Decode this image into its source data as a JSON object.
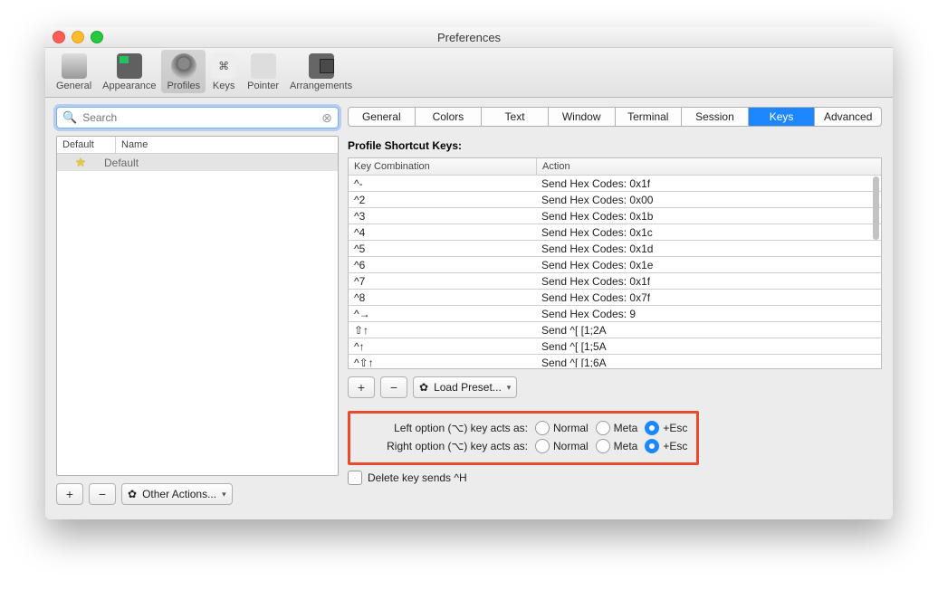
{
  "window": {
    "title": "Preferences"
  },
  "toolbar": [
    {
      "label": "General"
    },
    {
      "label": "Appearance"
    },
    {
      "label": "Profiles",
      "selected": true
    },
    {
      "label": "Keys",
      "glyph": "⌘"
    },
    {
      "label": "Pointer"
    },
    {
      "label": "Arrangements"
    }
  ],
  "search": {
    "placeholder": "Search"
  },
  "profile_headers": {
    "c1": "Default",
    "c2": "Name"
  },
  "profiles": [
    {
      "name": "Default",
      "is_default": true
    }
  ],
  "left_actions": {
    "add": "+",
    "remove": "−",
    "other": "Other Actions..."
  },
  "tabs": [
    "General",
    "Colors",
    "Text",
    "Window",
    "Terminal",
    "Session",
    "Keys",
    "Advanced"
  ],
  "active_tab": "Keys",
  "section_title": "Profile Shortcut Keys:",
  "table_headers": {
    "key": "Key Combination",
    "action": "Action"
  },
  "keys": [
    {
      "k": "^-",
      "a": "Send Hex Codes: 0x1f"
    },
    {
      "k": "^2",
      "a": "Send Hex Codes: 0x00"
    },
    {
      "k": "^3",
      "a": "Send Hex Codes: 0x1b"
    },
    {
      "k": "^4",
      "a": "Send Hex Codes: 0x1c"
    },
    {
      "k": "^5",
      "a": "Send Hex Codes: 0x1d"
    },
    {
      "k": "^6",
      "a": "Send Hex Codes: 0x1e"
    },
    {
      "k": "^7",
      "a": "Send Hex Codes: 0x1f"
    },
    {
      "k": "^8",
      "a": "Send Hex Codes: 0x7f"
    },
    {
      "k": "^→",
      "a": "Send Hex Codes: 9"
    },
    {
      "k": "⇧↑",
      "a": "Send ^[ [1;2A"
    },
    {
      "k": "^↑",
      "a": "Send ^[ [1;5A"
    },
    {
      "k": "^⇧↑",
      "a": "Send ^[ [1;6A"
    }
  ],
  "below": {
    "add": "+",
    "remove": "−",
    "preset": "Load Preset..."
  },
  "option_rows": [
    {
      "label": "Left option (⌥) key acts as:",
      "sel": "esc"
    },
    {
      "label": "Right option (⌥) key acts as:",
      "sel": "esc"
    }
  ],
  "radio_labels": {
    "normal": "Normal",
    "meta": "Meta",
    "esc": "+Esc"
  },
  "delete_label": "Delete key sends ^H"
}
